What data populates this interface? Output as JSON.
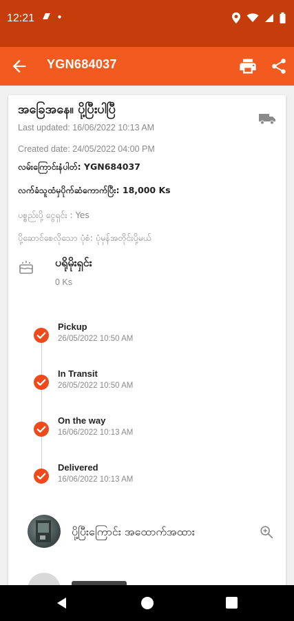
{
  "status_bar": {
    "time": "12:21"
  },
  "app_bar": {
    "title": "YGN684037"
  },
  "order": {
    "status_title": "အခြေအနေ။ ပို့ပြီးပါပြီ",
    "last_updated": "Last updated: 16/06/2022 10:13 AM",
    "created_date": "Created date: 24/05/2022 04:00 PM",
    "tracking": "လမ်းကြောင်းနံပါတ်: YGN684037",
    "delivery_fee": "လက်ခံသူထံမှပိုက်ဆံကောက်ပြီး: 18,000 Ks",
    "cod": "ပစ္စည်းပို့ ငွေရှင်း : Yes",
    "note": "ပို့ဆောင်စေလိုသော ပုံစံ: ပုံမှန်အတိုင်းပို့မယ်",
    "price_label": "ပရိုမိုးရှင်း",
    "price_value": "0 Ks"
  },
  "timeline": [
    {
      "label": "Pickup",
      "time": "26/05/2022 10:50 AM"
    },
    {
      "label": "In Transit",
      "time": "26/05/2022 10:50 AM"
    },
    {
      "label": "On the way",
      "time": "16/06/2022 10:13 AM"
    },
    {
      "label": "Delivered",
      "time": "16/06/2022 10:13 AM"
    }
  ],
  "proof": {
    "label": "ပို့ပြီးကြောင်း အထောက်အထား"
  },
  "colors": {
    "status_bar": "#c43d0b",
    "app_bar": "#f25a1f",
    "accent": "#f04a1c"
  }
}
